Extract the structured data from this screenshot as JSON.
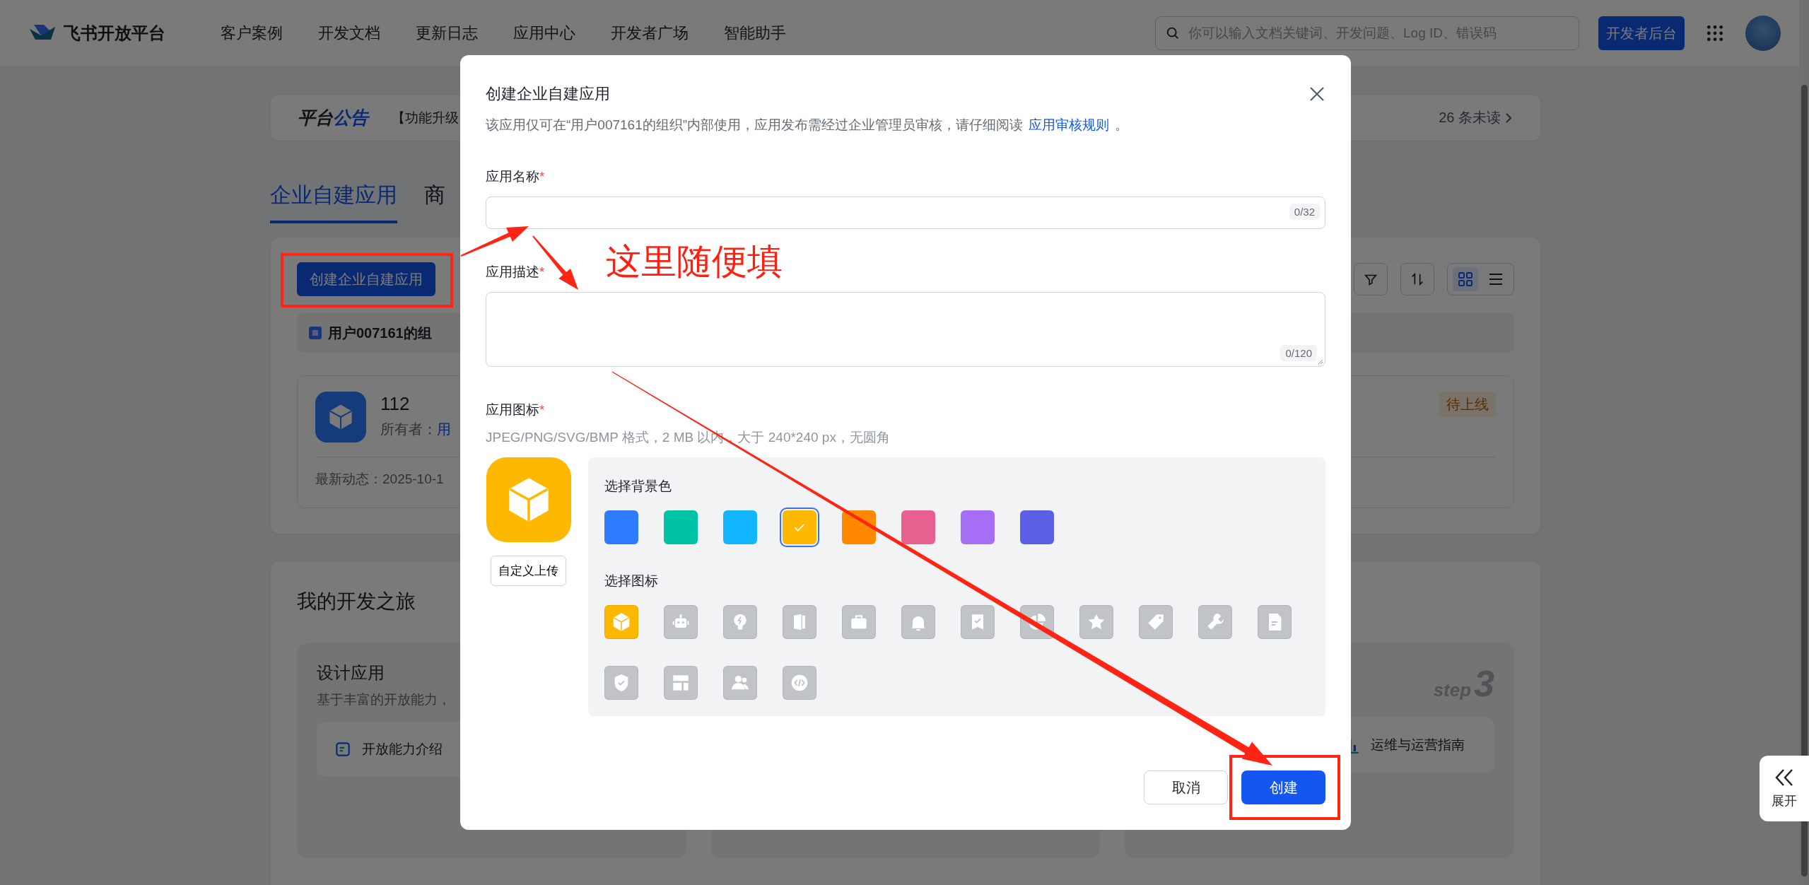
{
  "header": {
    "logo_text": "飞书开放平台",
    "nav": [
      "客户案例",
      "开发文档",
      "更新日志",
      "应用中心",
      "开发者广场",
      "智能助手"
    ],
    "search": {
      "placeholder": "你可以输入文档关键词、开发问题、Log ID、错误码"
    },
    "console_button": "开发者后台"
  },
  "announcement": {
    "title_main": "平台",
    "title_accent": "公告",
    "text": "【功能升级",
    "unread": "26 条未读"
  },
  "tabs": [
    {
      "label": "企业自建应用",
      "selected": true
    },
    {
      "label": "商",
      "selected": false
    }
  ],
  "apps_panel": {
    "create_button": "创建企业自建应用",
    "view_modes": [
      {
        "kind": "grid",
        "selected": true
      },
      {
        "kind": "list",
        "selected": false
      }
    ],
    "org_name": "用户007161的组",
    "apps": [
      {
        "name": "112",
        "owner_label": "所有者：",
        "owner": "用",
        "activity": "最新动态：2025-10-1",
        "status": "待上线"
      }
    ]
  },
  "journey": {
    "title": "我的开发之旅",
    "steps": [
      {
        "kind": "intro",
        "title": "设计应用",
        "description": "基于丰富的开放能力，",
        "link": "开放能力介绍"
      },
      {
        "kind": "covered"
      },
      {
        "kind": "step",
        "step_word": "step",
        "step_number": "3",
        "link": "运维与运营指南"
      }
    ]
  },
  "modal": {
    "title": "创建企业自建应用",
    "description": "该应用仅可在“用户007161的组织”内部使用，应用发布需经过企业管理员审核，请仔细阅读",
    "rules_link": "应用审核规则",
    "description_end": "。",
    "fields": [
      {
        "kind": "input",
        "label": "应用名称",
        "mark": "*",
        "counter": "0/32"
      },
      {
        "kind": "textarea",
        "label": "应用描述",
        "mark": "*",
        "counter": "0/120"
      }
    ],
    "icon_field": {
      "label": "应用图标",
      "mark": "*",
      "hint": "JPEG/PNG/SVG/BMP 格式，2 MB 以内，大于 240*240 px，无圆角",
      "upload_button": "自定义上传",
      "color_title": "选择背景色",
      "colors": [
        {
          "color": "#2f7bff",
          "selected": false
        },
        {
          "color": "#00c2a6",
          "selected": false
        },
        {
          "color": "#12b5ff",
          "selected": false
        },
        {
          "color": "#ffb800",
          "selected": true
        },
        {
          "color": "#ff8800",
          "selected": false
        },
        {
          "color": "#e8608f",
          "selected": false
        },
        {
          "color": "#a66ef5",
          "selected": false
        },
        {
          "color": "#5b5fe6",
          "selected": false
        }
      ],
      "icon_title": "选择图标",
      "icons": [
        {
          "selected": true
        },
        {
          "selected": false
        },
        {
          "selected": false
        },
        {
          "selected": false
        },
        {
          "selected": false
        },
        {
          "selected": false
        },
        {
          "selected": false
        },
        {
          "selected": false
        },
        {
          "selected": false
        },
        {
          "selected": false
        },
        {
          "selected": false
        },
        {
          "selected": false
        },
        {
          "selected": false
        },
        {
          "selected": false
        },
        {
          "selected": false
        },
        {
          "selected": false
        }
      ]
    },
    "buttons": [
      {
        "kind": "secondary",
        "label": "取消"
      },
      {
        "kind": "primary",
        "label": "创建"
      }
    ]
  },
  "annotation": {
    "note": "这里随便填"
  },
  "side_panel": {
    "expand_label": "展开"
  }
}
